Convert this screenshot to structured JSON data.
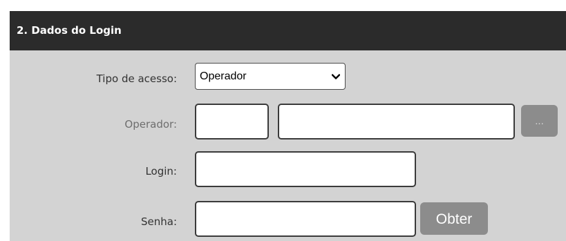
{
  "section": {
    "title": "2. Dados do Login"
  },
  "form": {
    "tipo_acesso": {
      "label": "Tipo de acesso:",
      "selected": "Operador"
    },
    "operador": {
      "label": "Operador:",
      "code_value": "",
      "name_value": "",
      "lookup_button": "..."
    },
    "login": {
      "label": "Login:",
      "value": ""
    },
    "senha": {
      "label": "Senha:",
      "value": "",
      "obter_button": "Obter"
    }
  },
  "icons": {
    "select_arrow": "chevron-down-icon"
  }
}
